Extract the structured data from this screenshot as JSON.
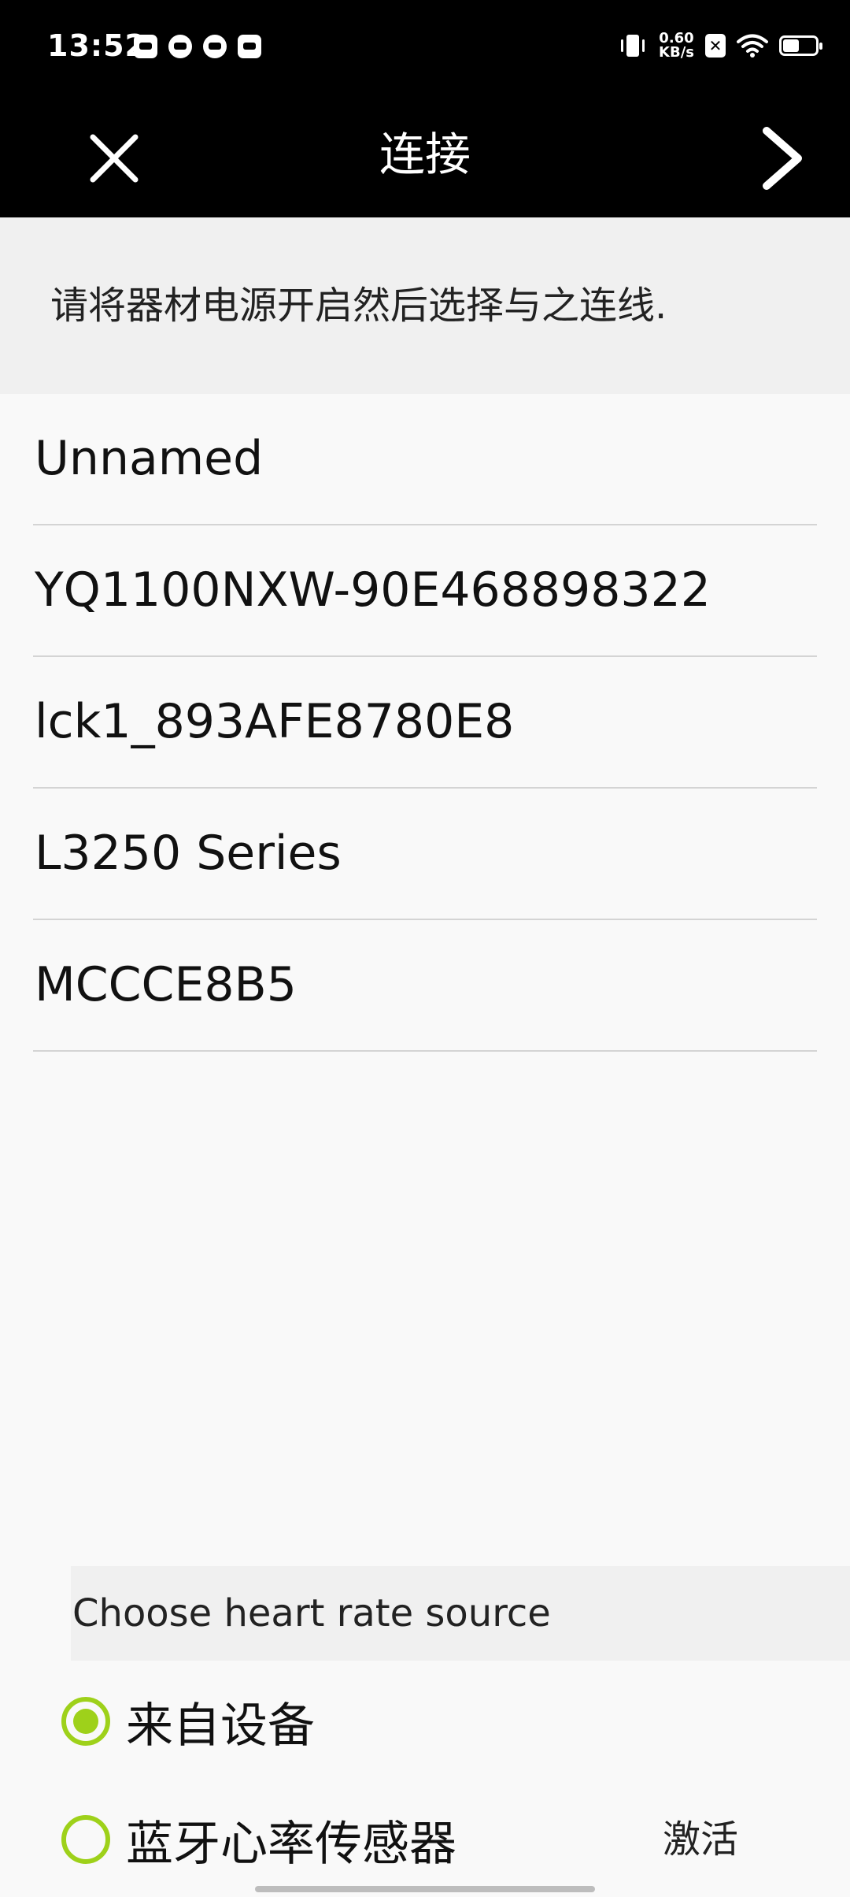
{
  "status_bar": {
    "time": "13:52",
    "net_speed_value": "0.60",
    "net_speed_unit": "KB/s",
    "app_icons": [
      "mail-app-icon",
      "leaf-app-icon",
      "cat-app-icon",
      "inbox-app-icon"
    ],
    "battery_level": 0.5
  },
  "nav": {
    "title": "连接",
    "close_icon": "close-icon",
    "next_icon": "chevron-right-icon"
  },
  "instruction": "请将器材电源开启然后选择与之连线.",
  "devices": [
    {
      "name": "Unnamed"
    },
    {
      "name": "YQ1100NXW-90E468898322"
    },
    {
      "name": "lck1_893AFE8780E8"
    },
    {
      "name": "L3250 Series"
    },
    {
      "name": "MCCCE8B5"
    }
  ],
  "heart_rate": {
    "header": "Choose heart rate source",
    "options": [
      {
        "label": "来自设备",
        "checked": true
      },
      {
        "label": "蓝牙心率传感器",
        "checked": false
      }
    ],
    "activate_label": "激活"
  },
  "colors": {
    "accent": "#9ed11a",
    "bar_background": "#000000",
    "page_background": "#f9f9f9"
  }
}
